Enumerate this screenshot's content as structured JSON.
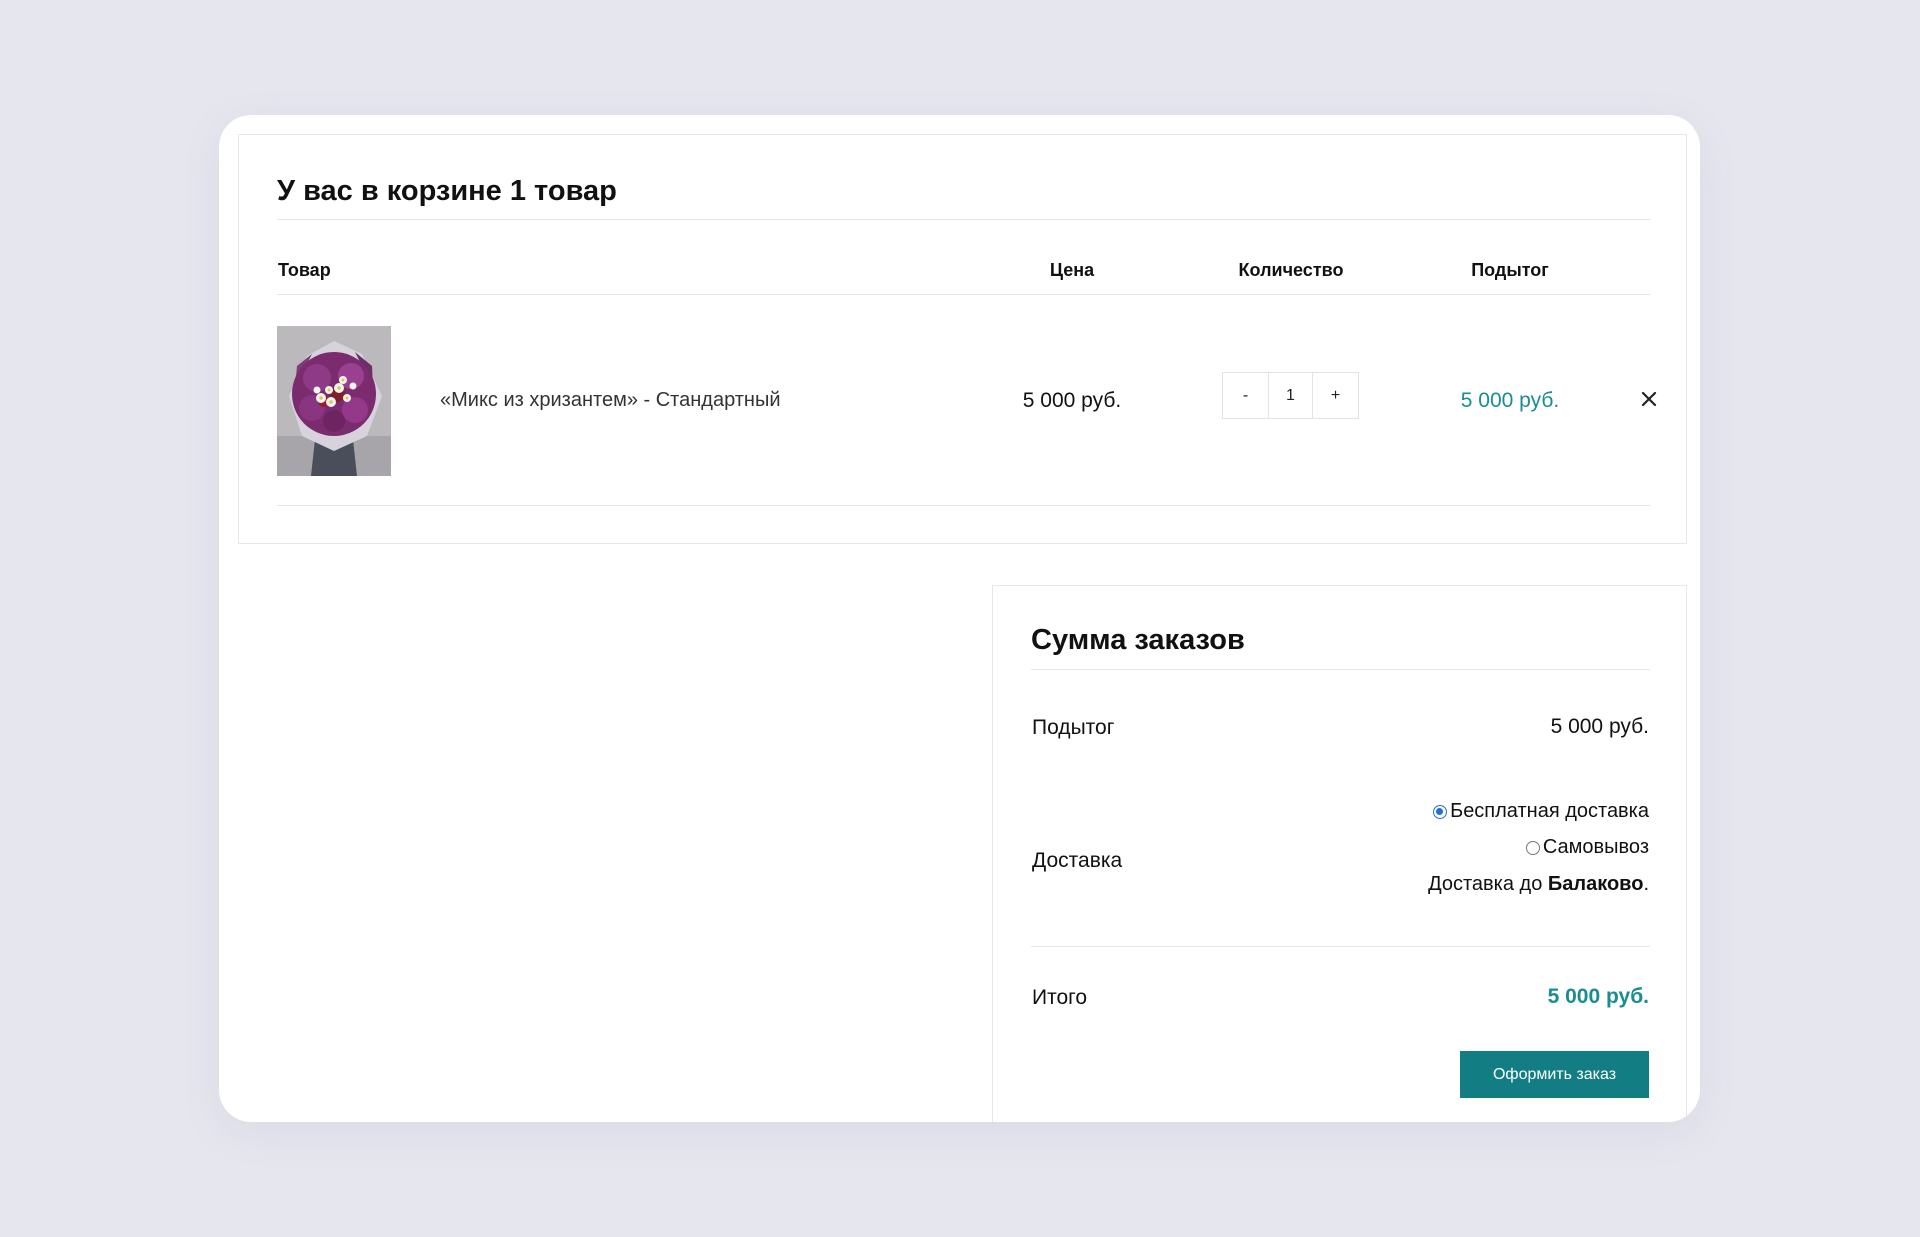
{
  "cart": {
    "title": "У вас в корзине 1 товар",
    "headers": {
      "product": "Товар",
      "price": "Цена",
      "quantity": "Количество",
      "subtotal": "Подытог"
    },
    "items": [
      {
        "name": "«Микс из хризантем» - Стандартный",
        "price": "5 000 руб.",
        "quantity": "1",
        "decrement_label": "-",
        "increment_label": "+",
        "subtotal": "5 000 руб.",
        "image_icon": "bouquet-image",
        "remove_icon": "close-icon"
      }
    ]
  },
  "totals": {
    "title": "Сумма заказов",
    "subtotal_label": "Подытог",
    "subtotal_value": "5 000 руб.",
    "shipping_label": "Доставка",
    "shipping_options": [
      {
        "label": "Бесплатная доставка",
        "selected": true
      },
      {
        "label": "Самовывоз",
        "selected": false
      }
    ],
    "shipping_destination_prefix": "Доставка до ",
    "shipping_destination_city": "Балаково",
    "shipping_destination_suffix": ".",
    "total_label": "Итого",
    "total_value": "5 000 руб.",
    "checkout_label": "Оформить заказ"
  },
  "colors": {
    "background": "#e6e6ef",
    "accent": "#1a8d93",
    "button": "#127e84",
    "radio_selected": "#1f6fe0"
  }
}
